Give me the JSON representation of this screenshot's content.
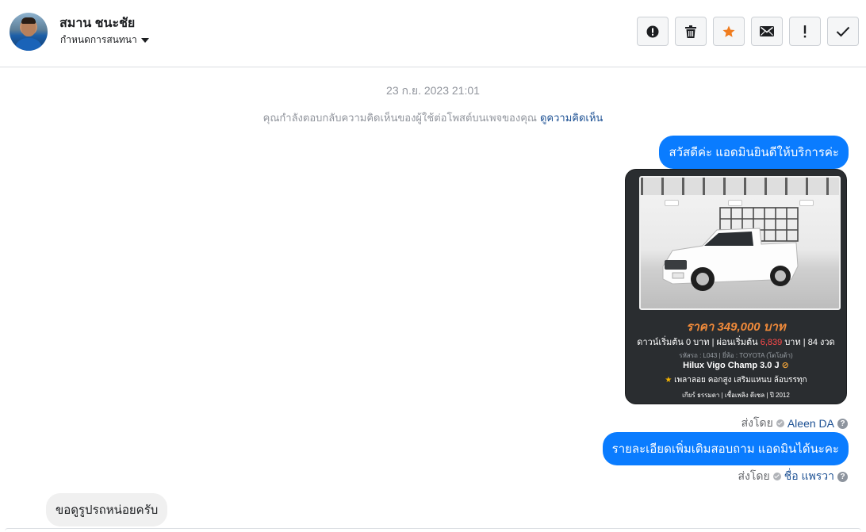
{
  "header": {
    "contact_name": "สมาน ชนะชัย",
    "conversation_settings_label": "กำหนดการสนทนา",
    "toolbar": {
      "icons": [
        "alert-circle-icon",
        "trash-icon",
        "star-icon",
        "envelope-icon",
        "exclamation-icon",
        "check-icon"
      ],
      "star_color": "#f07c1e"
    }
  },
  "thread": {
    "timestamp": "23 ก.ย. 2023 21:01",
    "notice_text": "คุณกำลังตอบกลับความคิดเห็นของผู้ใช้ต่อโพสต์บนเพจของคุณ",
    "notice_link": "ดูความคิดเห็น",
    "messages": [
      {
        "direction": "outgoing",
        "text": "สวัสดีค่ะ แอดมินยินดีให้บริการค่ะ"
      },
      {
        "direction": "outgoing",
        "type": "image",
        "card": {
          "price": "ราคา 349,000 บาท",
          "down_prefix": "ดาวน์เริ่มต้น 0 บาท | ผ่อนเริ่มต้น",
          "installment": "6,839",
          "down_suffix": "บาท | 84 งวด",
          "meta": "รหัสรถ : L043 | ยี่ห้อ : TOYOTA (โตโยต้า)",
          "model": "Hilux Vigo Champ 3.0 J",
          "features": "เพลาลอย คอกสูง เสริมแหนบ ล้อบรรทุก",
          "specs": "เกียร์ ธรรมดา | เชื้อเพลิง ดีเซล | ปี 2012"
        }
      },
      {
        "direction": "outgoing",
        "text": "รายละเอียดเพิ่มเติมสอบถาม แอดมินได้นะคะ"
      },
      {
        "direction": "incoming",
        "text": "ขอดูรูปรถหน่อยครับ"
      }
    ],
    "sent_by_label": "ส่งโดย",
    "sender_1": "Aleen DA",
    "sender_2": "ชื่อ แพรวา"
  },
  "colors": {
    "outgoing_bubble": "#0a7cff",
    "incoming_bubble": "#f0f0f0",
    "link": "#1d5194",
    "price": "#f08a3a",
    "installment": "#ff4a4a"
  }
}
